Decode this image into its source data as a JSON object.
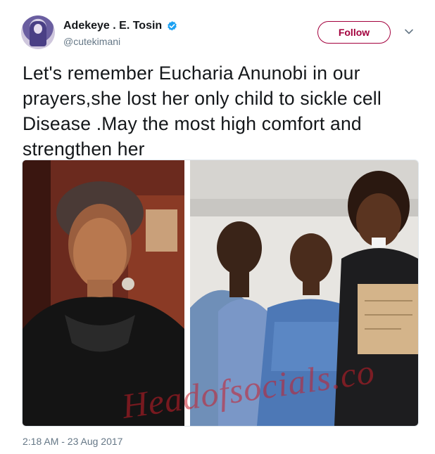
{
  "author": {
    "display_name": "Adekeye . E. Tosin",
    "handle": "@cutekimani",
    "verified_icon": "verified-badge-icon",
    "avatar_icon": "avatar-image"
  },
  "actions": {
    "follow_label": "Follow",
    "menu_icon": "chevron-down-icon"
  },
  "tweet": {
    "text": "Let's remember Eucharia Anunobi in our prayers,she lost her only child to sickle cell Disease  .May the most high comfort and strengthen her",
    "timestamp": "2:18 AM - 23 Aug 2017"
  },
  "media": {
    "watermark": "Headofsocials.co"
  },
  "colors": {
    "accent": "#a3003d",
    "verified": "#1da1f2",
    "secondary_text": "#657786",
    "primary_text": "#14171a"
  }
}
